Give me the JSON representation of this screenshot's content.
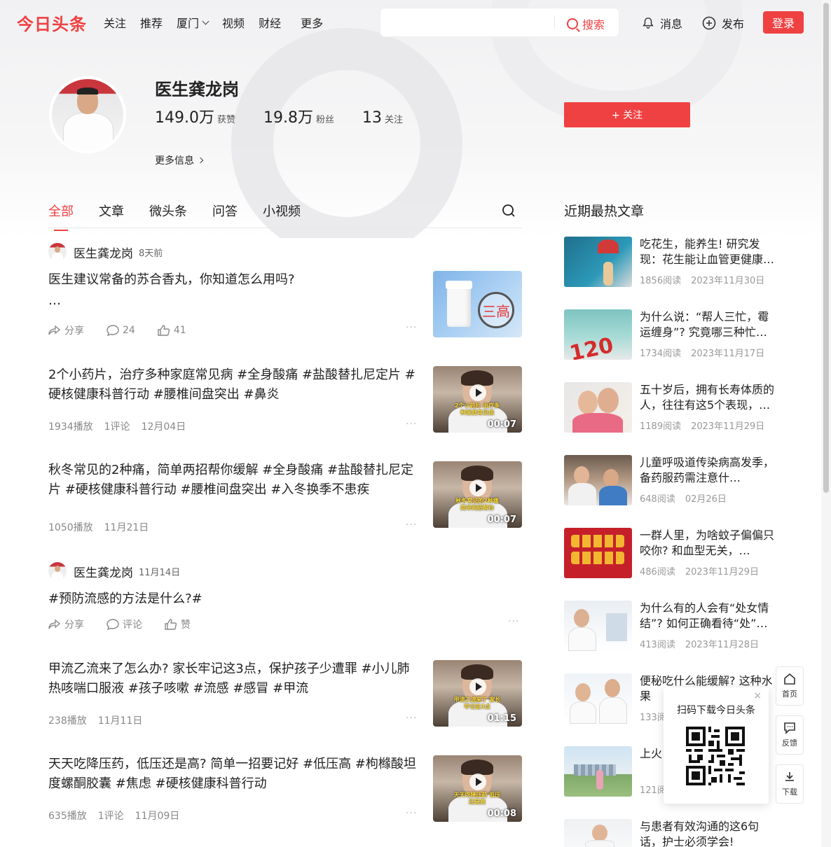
{
  "header": {
    "logo": "今日头条",
    "nav": [
      {
        "label": "关注"
      },
      {
        "label": "推荐"
      },
      {
        "label": "厦门"
      },
      {
        "label": "视频"
      },
      {
        "label": "财经"
      },
      {
        "label": "更多"
      }
    ],
    "search_placeholder": "",
    "search_label": "搜索",
    "messages_label": "消息",
    "publish_label": "发布",
    "login_label": "登录"
  },
  "profile": {
    "name": "医生龚龙岗",
    "likes_value": "149.0万",
    "likes_label": "获赞",
    "fans_value": "19.8万",
    "fans_label": "粉丝",
    "following_value": "13",
    "following_label": "关注",
    "more_info": "更多信息",
    "follow_button": "+ 关注"
  },
  "tabs": [
    {
      "label": "全部"
    },
    {
      "label": "文章"
    },
    {
      "label": "微头条"
    },
    {
      "label": "问答"
    },
    {
      "label": "小视频"
    }
  ],
  "feed": {
    "item1": {
      "author": "医生龚龙岗",
      "time": "8天前",
      "title": "医生建议常备的苏合香丸，你知道怎么用吗?",
      "ellipsis": "…",
      "share": "分享",
      "comments": "24",
      "likes": "41",
      "thumb_text": "三高"
    },
    "item2": {
      "title": "2个小药片，治疗多种家庭常见病 #全身酸痛 #盐酸替扎尼定片 #硬核健康科普行动 #腰椎间盘突出 #鼻炎",
      "plays": "1934播放",
      "comments": "1评论",
      "date": "12月04日",
      "duration": "00:07",
      "caption": "2个小药片 治疗多种家庭常见病"
    },
    "item3": {
      "title": "秋冬常见的2种痛，简单两招帮你缓解 #全身酸痛 #盐酸替扎尼定片 #硬核健康科普行动 #腰椎间盘突出 #入冬换季不患疾",
      "plays": "1050播放",
      "date": "11月21日",
      "duration": "00:07",
      "caption": "秋冬常见的2种痛 简单两招帮你"
    },
    "item4": {
      "author": "医生龚龙岗",
      "time": "11月14日",
      "title": "#预防流感的方法是什么?#",
      "share": "分享",
      "comment": "评论",
      "like": "赞"
    },
    "item5": {
      "title": "甲流乙流来了怎么办? 家长牢记这3点，保护孩子少遭罪 #小儿肺热咳喘口服液 #孩子咳嗽 #流感 #感冒 #甲流",
      "plays": "238播放",
      "date": "11月11日",
      "duration": "01:15",
      "caption": "甲流乙流来了 家长牢记这3点"
    },
    "item6": {
      "title": "天天吃降压药，低压还是高? 简单一招要记好 #低压高 #枸橼酸坦度螺酮胶囊 #焦虑 #硬核健康科普行动",
      "plays": "635播放",
      "comments": "1评论",
      "date": "11月09日",
      "duration": "00:08",
      "caption": "天天吃降压药 低压还是高"
    }
  },
  "hot": {
    "title": "近期最热文章",
    "items": [
      {
        "title": "吃花生，能养生! 研究发现：花生能让血管更健康…",
        "reads": "1856阅读",
        "date": "2023年11月30日"
      },
      {
        "title": "为什么说：“帮人三忙，霉运缠身”? 究竟哪三种忙…",
        "reads": "1734阅读",
        "date": "2023年11月17日"
      },
      {
        "title": "五十岁后，拥有长寿体质的人，往往有这5个表现，…",
        "reads": "1189阅读",
        "date": "2023年11月29日"
      },
      {
        "title": "儿童呼吸道传染病高发季，备药服药需注意什…",
        "reads": "648阅读",
        "date": "02月26日"
      },
      {
        "title": "一群人里，为啥蚊子偏偏只咬你? 和血型无关，…",
        "reads": "486阅读",
        "date": "2023年11月29日"
      },
      {
        "title": "为什么有的人会有“处女情结”? 如何正确看待“处”…",
        "reads": "413阅读",
        "date": "2023年11月28日"
      },
      {
        "title": "便秘吃什么能缓解? 这种水果",
        "reads": "133阅",
        "date": ""
      },
      {
        "title": "上火 肝火",
        "reads": "121阅",
        "date": ""
      },
      {
        "title": "与患者有效沟通的这6句话，护士必须学会!",
        "reads": "",
        "date": ""
      }
    ]
  },
  "side": {
    "home": "首页",
    "feedback": "反馈",
    "download": "下载",
    "qr_title": "扫码下载今日头条",
    "close": "×"
  }
}
